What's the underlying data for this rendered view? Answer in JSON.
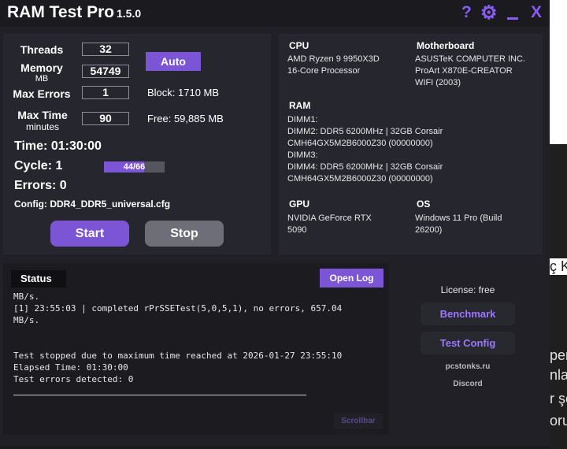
{
  "app": {
    "title": "RAM Test Pro",
    "version": "1.5.0"
  },
  "titlebar": {
    "help_glyph": "?",
    "settings_glyph": "⚙",
    "close_glyph": "X"
  },
  "config": {
    "threads_label": "Threads",
    "threads_value": "32",
    "memory_label": "Memory",
    "memory_unit": "MB",
    "memory_value": "54749",
    "max_errors_label": "Max Errors",
    "max_errors_value": "1",
    "max_time_label": "Max Time",
    "max_time_unit": "minutes",
    "max_time_value": "90",
    "auto_label": "Auto",
    "block": "Block:   1710 MB",
    "free": "Free:   59,885 MB"
  },
  "stats": {
    "time": "Time:   01:30:00",
    "cycle_label": "Cycle:   1",
    "cycle_progress_text": "44/66",
    "cycle_progress": 0.667,
    "errors": "Errors:   0",
    "config_file": "Config: DDR4_DDR5_universal.cfg"
  },
  "buttons": {
    "start": "Start",
    "stop": "Stop"
  },
  "system": {
    "cpu_header": "CPU",
    "cpu_value": "AMD Ryzen 9 9950X3D\n16-Core Processor",
    "mb_header": "Motherboard",
    "mb_value": "ASUSTeK COMPUTER INC.\nProArt X870E-CREATOR\nWIFI (2003)",
    "ram_header": "RAM",
    "ram_value": "DIMM1:\nDIMM2: DDR5 6200MHz | 32GB Corsair\nCMH64GX5M2B6000Z30 (00000000)\nDIMM3:\nDIMM4: DDR5 6200MHz | 32GB Corsair\nCMH64GX5M2B6000Z30 (00000000)",
    "gpu_header": "GPU",
    "gpu_value": "NVIDIA GeForce RTX\n5090",
    "os_header": "OS",
    "os_value": "Windows 11 Pro (Build\n26200)"
  },
  "status": {
    "tab": "Status",
    "open_log": "Open Log",
    "log": "MB/s.\n[1] 23:55:03 | completed rPrSSETest(5,0,5,1), no errors, 657.04\nMB/s.\n\n\nTest stopped due to maximum time reached at 2026-01-27 23:55:10\nElapsed Time: 01:30:00\nTest errors detected: 0",
    "scrollbar": "Scrollbar"
  },
  "side": {
    "license": "License: free",
    "benchmark": "Benchmark",
    "test_config": "Test Config",
    "site": "pcstonks.ru",
    "discord": "Discord"
  },
  "background": {
    "text_1": "ç K",
    "text_2": "per",
    "text_3": "nla",
    "text_4": "r şe",
    "text_5": "oru"
  },
  "colors": {
    "accent": "#7b55d6",
    "window_bg": "#202026",
    "panel_bg": "#26262e"
  }
}
